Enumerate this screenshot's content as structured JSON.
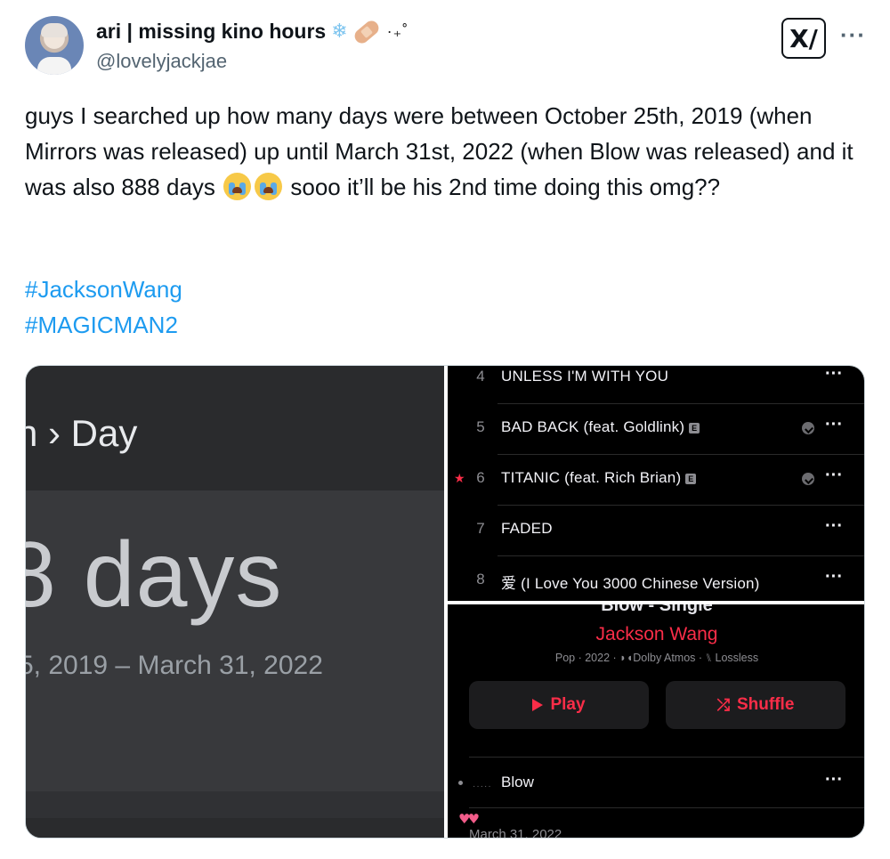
{
  "author": {
    "display_name": "ari | missing kino hours",
    "name_emojis": [
      "snowflake-emoji",
      "bandage-emoji"
    ],
    "name_sparkle": "·₊˚",
    "handle": "@lovelyjackjae",
    "avatar_icon": "avatar"
  },
  "header": {
    "grok_label": "X/",
    "more_label": "···"
  },
  "tweet": {
    "text_before_emoji": "guys I searched up how many days were between October 25th, 2019 (when Mirrors was released) up until March 31st, 2022 (when Blow was released) and it was also 888 days",
    "text_after_emoji": " sooo it’ll be his 2nd time doing this omg??",
    "hashtags": [
      "#JacksonWang",
      "#MAGICMAN2"
    ]
  },
  "media": {
    "calculator": {
      "breadcrumb": "n › Day",
      "result": "8 days",
      "range": "5, 2019 – March 31, 2022"
    },
    "tracklist": [
      {
        "num": "4",
        "title": "UNLESS I'M WITH YOU",
        "explicit": false,
        "download": false,
        "starred": false
      },
      {
        "num": "5",
        "title": "BAD BACK (feat. Goldlink)",
        "explicit": true,
        "download": true,
        "starred": false
      },
      {
        "num": "6",
        "title": "TITANIC (feat. Rich Brian)",
        "explicit": true,
        "download": true,
        "starred": true
      },
      {
        "num": "7",
        "title": "FADED",
        "explicit": false,
        "download": false,
        "starred": false
      },
      {
        "num": "8",
        "title": "爱 (I Love You 3000 Chinese Version)",
        "explicit": false,
        "download": false,
        "starred": false
      }
    ],
    "explicit_badge": "E",
    "more_label": "···",
    "album": {
      "title": "Blow - Single",
      "artist": "Jackson Wang",
      "meta": "Pop · 2022 · ◗◖Dolby Atmos · ⑊ Lossless",
      "play_label": "Play",
      "shuffle_label": "Shuffle",
      "song": "Blow",
      "release_date": "March 31, 2022",
      "accent_color": "#fa2d48"
    }
  }
}
